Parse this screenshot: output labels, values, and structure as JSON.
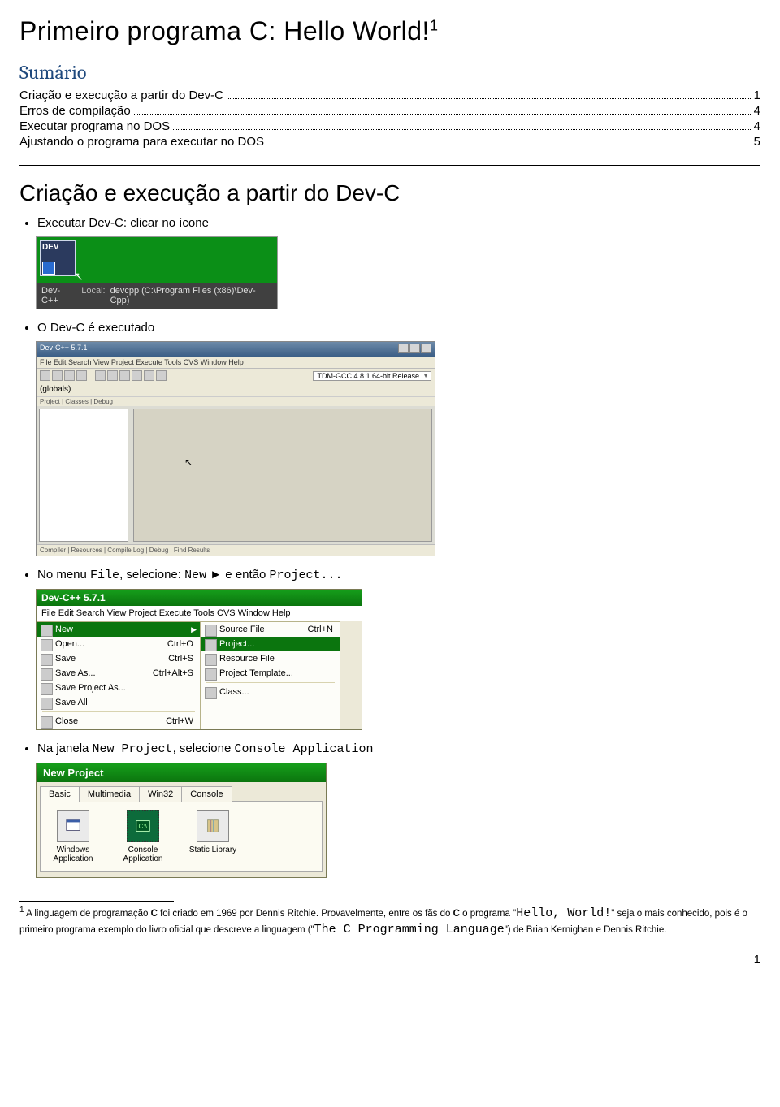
{
  "title": "Primeiro programa C: Hello World!",
  "title_footnote_mark": "1",
  "sumario_heading": "Sumário",
  "toc": [
    {
      "label": "Criação e execução a partir do Dev-C",
      "page": "1"
    },
    {
      "label": "Erros de compilação",
      "page": "4"
    },
    {
      "label": "Executar programa no DOS",
      "page": "4"
    },
    {
      "label": "Ajustando o programa para executar no DOS",
      "page": "5"
    }
  ],
  "section_heading": "Criação e execução a partir do Dev-C",
  "bullets": {
    "b1": "Executar Dev-C: clicar no ícone",
    "b2": "O Dev-C é executado",
    "b3_pre": "No menu ",
    "b3_mono1": "File",
    "b3_mid1": ", selecione: ",
    "b3_mono2": "New",
    "b3_mid2": " ► e então ",
    "b3_mono3": "Project...",
    "b4_pre": "Na janela ",
    "b4_mono1": "New Project",
    "b4_mid": ", selecione ",
    "b4_mono2": "Console Application"
  },
  "shot_icon": {
    "logo_text": "DEV",
    "bar_app": "Dev-C++",
    "bar_prefix": "Local:",
    "bar_path": "devcpp (C:\\Program Files (x86)\\Dev-Cpp)"
  },
  "shot_ide": {
    "title": "Dev-C++ 5.7.1",
    "menu": "File  Edit  Search  View  Project  Execute  Tools  CVS  Window  Help",
    "combo1": "(globals)",
    "combo2": "TDM-GCC 4.8.1 64-bit Release",
    "side_tabs": "Project | Classes | Debug",
    "bottom_tabs": "Compiler | Resources | Compile Log | Debug | Find Results"
  },
  "shot_menu": {
    "title": "Dev-C++ 5.7.1",
    "menubar": "File  Edit  Search  View  Project  Execute  Tools  CVS  Window  Help",
    "left": [
      {
        "label": "New",
        "shortcut": "",
        "selected": true,
        "arrow": true
      },
      {
        "label": "Open...",
        "shortcut": "Ctrl+O"
      },
      {
        "label": "Save",
        "shortcut": "Ctrl+S"
      },
      {
        "label": "Save As...",
        "shortcut": "Ctrl+Alt+S"
      },
      {
        "label": "Save Project As..."
      },
      {
        "label": "Save All"
      },
      {
        "divider": true
      },
      {
        "label": "Close",
        "shortcut": "Ctrl+W"
      }
    ],
    "right": [
      {
        "label": "Source File",
        "shortcut": "Ctrl+N"
      },
      {
        "label": "Project...",
        "selected": true
      },
      {
        "label": "Resource File"
      },
      {
        "label": "Project Template..."
      },
      {
        "divider": true
      },
      {
        "label": "Class..."
      }
    ]
  },
  "shot_np": {
    "title": "New Project",
    "tabs": [
      "Basic",
      "Multimedia",
      "Win32",
      "Console"
    ],
    "active_tab": 0,
    "items": [
      {
        "label": "Windows Application"
      },
      {
        "label": "Console Application",
        "selected": true
      },
      {
        "label": "Static Library"
      }
    ]
  },
  "footnote": {
    "num": "1",
    "t1": " A linguagem de programação ",
    "bold1": "C",
    "t2": " foi criado em 1969 por Dennis Ritchie. Provavelmente, entre os fãs do ",
    "bold2": "C",
    "t3": " o programa \"",
    "mono1": "Hello, World!",
    "t4": "\" seja o mais conhecido, pois é o primeiro programa exemplo do livro oficial que descreve a linguagem (\"",
    "mono2": "The C Programming Language",
    "t5": "\") de Brian Kernighan e Dennis Ritchie."
  },
  "page_number": "1"
}
